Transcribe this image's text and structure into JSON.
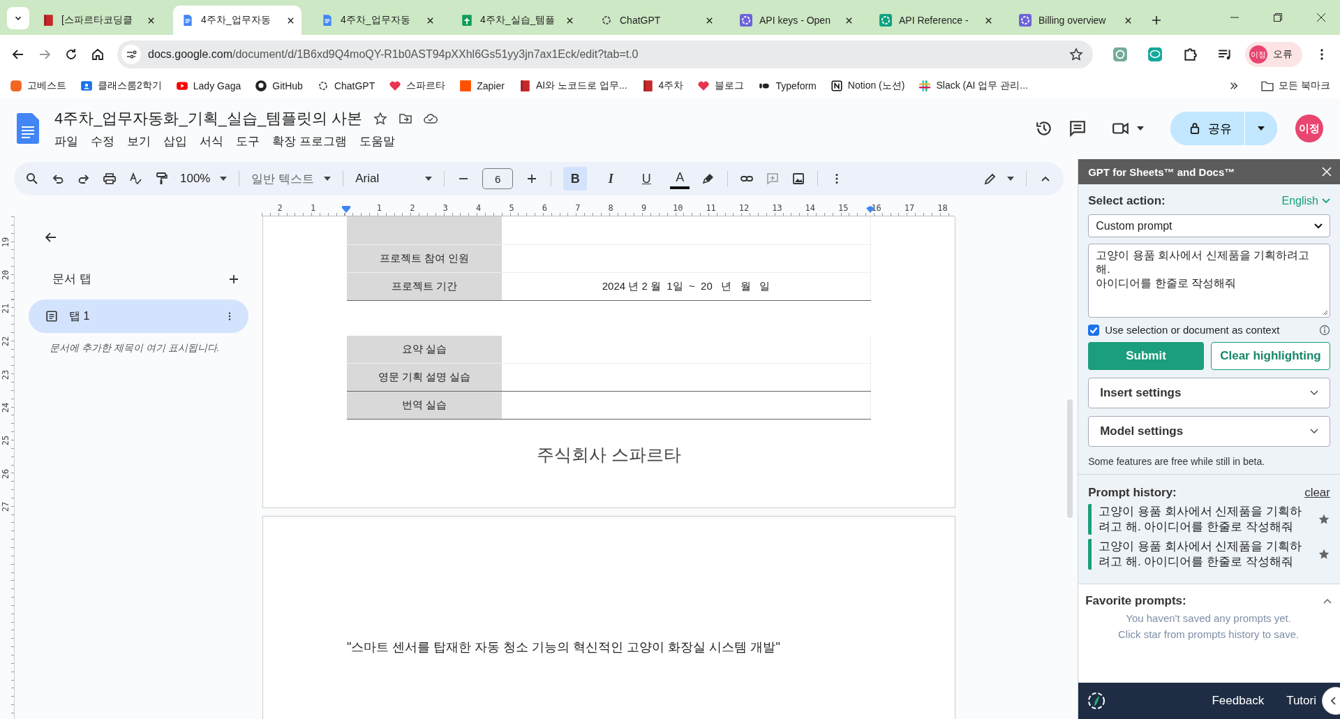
{
  "browser": {
    "tabs": [
      {
        "title": "[스파르타코딩클",
        "kind": "book",
        "selected": false
      },
      {
        "title": "4주차_업무자동",
        "kind": "docs",
        "selected": true
      },
      {
        "title": "4주차_업무자동",
        "kind": "docs",
        "selected": false
      },
      {
        "title": "4주차_실습_템플",
        "kind": "sheets",
        "selected": false
      },
      {
        "title": "ChatGPT",
        "kind": "knot",
        "selected": false
      },
      {
        "title": "API keys - Open",
        "kind": "knot-purple",
        "selected": false
      },
      {
        "title": "API Reference -",
        "kind": "knot-green",
        "selected": false
      },
      {
        "title": "Billing overview",
        "kind": "knot-purple",
        "selected": false
      }
    ],
    "address": {
      "host": "docs.google.com",
      "path": "/document/d/1B6xd9Q4moQY-R1b0AST94pXXhl6Gs51yy3jn7ax1Eck/edit?tab=t.0"
    },
    "profile": {
      "avatar": "이정",
      "status": "오류"
    },
    "bookmarks": [
      {
        "label": "고베스트",
        "kind": "orange"
      },
      {
        "label": "클래스룸2학기",
        "kind": "person"
      },
      {
        "label": "Lady Gaga",
        "kind": "youtube"
      },
      {
        "label": "GitHub",
        "kind": "github"
      },
      {
        "label": "ChatGPT",
        "kind": "knot"
      },
      {
        "label": "스파르타",
        "kind": "heart"
      },
      {
        "label": "Zapier",
        "kind": "square"
      },
      {
        "label": "AI와 노코드로 업무...",
        "kind": "book"
      },
      {
        "label": "4주차",
        "kind": "book"
      },
      {
        "label": "블로그",
        "kind": "heart"
      },
      {
        "label": "Typeform",
        "kind": "typeform"
      },
      {
        "label": "Notion (노션)",
        "kind": "notion"
      },
      {
        "label": "Slack (AI 업무 관리...",
        "kind": "slack"
      }
    ],
    "all_bookmarks": "모든 북마크"
  },
  "docs": {
    "title": "4주차_업무자동화_기획_실습_템플릿의 사본",
    "menu": [
      "파일",
      "수정",
      "보기",
      "삽입",
      "서식",
      "도구",
      "확장 프로그램",
      "도움말"
    ],
    "share": "공유",
    "avatar": "이정",
    "toolbar": {
      "zoom": "100%",
      "style": "일반 텍스트",
      "font": "Arial",
      "font_size": "6",
      "format": [
        {
          "label": "B",
          "selected": true
        },
        {
          "label": "I",
          "selected": false
        },
        {
          "label": "U",
          "selected": false
        },
        {
          "label": "A",
          "selected": false
        }
      ]
    },
    "ruler": [
      "2",
      "1",
      "1",
      "2",
      "3",
      "4",
      "5",
      "6",
      "7",
      "8",
      "9",
      "10",
      "11",
      "12",
      "13",
      "14",
      "15",
      "16",
      "17",
      "18"
    ],
    "vertical_ruler": [
      "19",
      "20",
      "21",
      "22",
      "23",
      "24",
      "25",
      "26",
      "27"
    ],
    "outline": {
      "heading": "문서 탭",
      "tabs": [
        {
          "label": "탭 1",
          "selected": true
        }
      ],
      "hint": "문서에 추가한 제목이 여기 표시됩니다."
    },
    "table_1": [
      {
        "label": "프로젝트 참여 인원"
      },
      {
        "label": "프로젝트 기간",
        "value": "2024 년 2 월  1일  ~  20   년   월   일"
      }
    ],
    "table_2": [
      {
        "label": "요약 실습"
      },
      {
        "label": "영문 기획 설명 실습"
      },
      {
        "label": "번역 실습"
      }
    ],
    "company": "주식회사 스파르타",
    "page_2_text": "\"스마트 센서를 탑재한 자동 청소 기능의 혁신적인 고양이 화장실 시스템 개발\""
  },
  "panel": {
    "title": "GPT for Sheets™ and Docs™",
    "select_label": "Select action:",
    "language": "English",
    "action": "Custom prompt",
    "prompt": "고양이 용품 회사에서 신제품을 기획하려고 해.\n아이디어를 한줄로 작성해줘",
    "context": {
      "label": "Use selection or document as context",
      "checked": true
    },
    "submit": "Submit",
    "clear_highlighting": "Clear highlighting",
    "sections": [
      "Insert settings",
      "Model settings"
    ],
    "note": "Some features are free while still in beta.",
    "history_title": "Prompt history:",
    "history_clear": "clear",
    "history": [
      "고양이 용품 회사에서 신제품을 기획하려고 해. 아이디어를 한줄로 작성해줘",
      "고양이 용품 회사에서 신제품을 기획하려고 해. 아이디어를 한줄로 작성해줘"
    ],
    "favorites_title": "Favorite prompts:",
    "favorites_empty": [
      "You haven't saved any prompts yet.",
      "Click star from prompts history to save."
    ],
    "footer": [
      "Feedback",
      "Tutori"
    ]
  }
}
